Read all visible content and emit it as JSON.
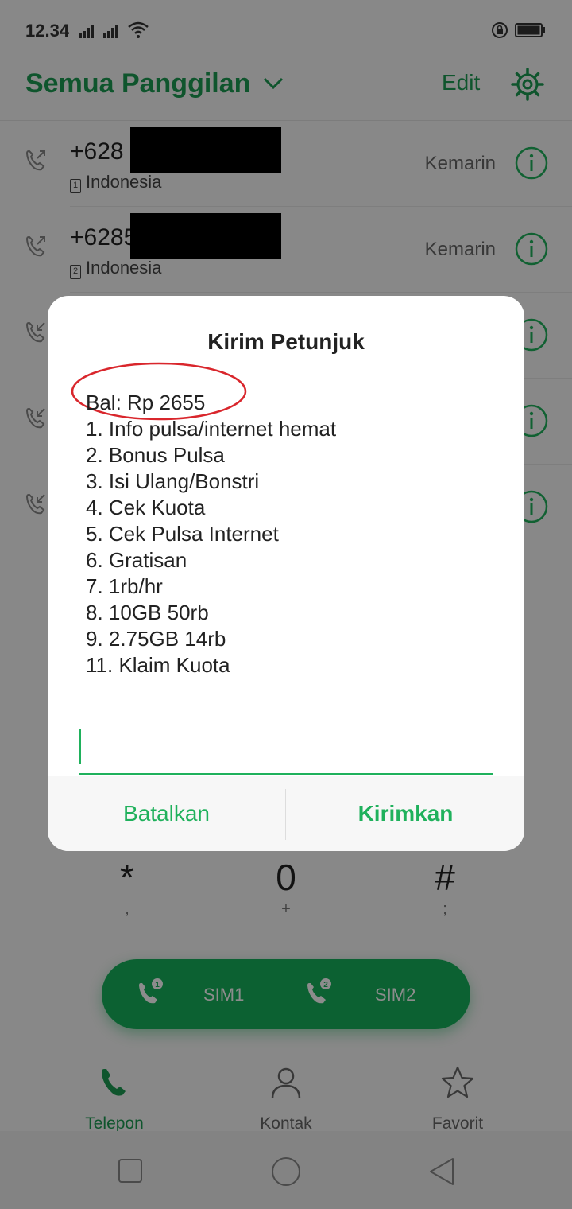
{
  "status_bar": {
    "time": "12.34"
  },
  "header": {
    "title": "Semua Panggilan",
    "edit_label": "Edit"
  },
  "call_log": [
    {
      "number": "+628",
      "sim": "1",
      "location": "Indonesia",
      "when": "Kemarin",
      "direction": "outgoing"
    },
    {
      "number": "+6285",
      "sim": "2",
      "location": "Indonesia",
      "when": "Kemarin",
      "direction": "outgoing"
    }
  ],
  "dialpad": {
    "keys": [
      {
        "main": "*",
        "sub": ","
      },
      {
        "main": "0",
        "sub": "+"
      },
      {
        "main": "#",
        "sub": ";"
      }
    ]
  },
  "call_button": {
    "sim1_label": "SIM1",
    "sim2_label": "SIM2"
  },
  "bottom_nav": [
    {
      "label": "Telepon",
      "icon": "phone-icon",
      "active": true
    },
    {
      "label": "Kontak",
      "icon": "person-icon",
      "active": false
    },
    {
      "label": "Favorit",
      "icon": "star-icon",
      "active": false
    }
  ],
  "dialog": {
    "title": "Kirim Petunjuk",
    "lines": [
      "Bal: Rp 2655",
      "1. Info pulsa/internet hemat",
      "2. Bonus Pulsa",
      "3. Isi Ulang/Bonstri",
      "4. Cek Kuota",
      "5. Cek Pulsa Internet",
      "6. Gratisan",
      "7. 1rb/hr",
      "8. 10GB 50rb",
      "9. 2.75GB 14rb",
      "11. Klaim Kuota"
    ],
    "input_value": "",
    "cancel_label": "Batalkan",
    "send_label": "Kirimkan"
  },
  "colors": {
    "accent": "#1fb15c",
    "call_button": "#17b15b",
    "annotation": "#d9262c"
  }
}
